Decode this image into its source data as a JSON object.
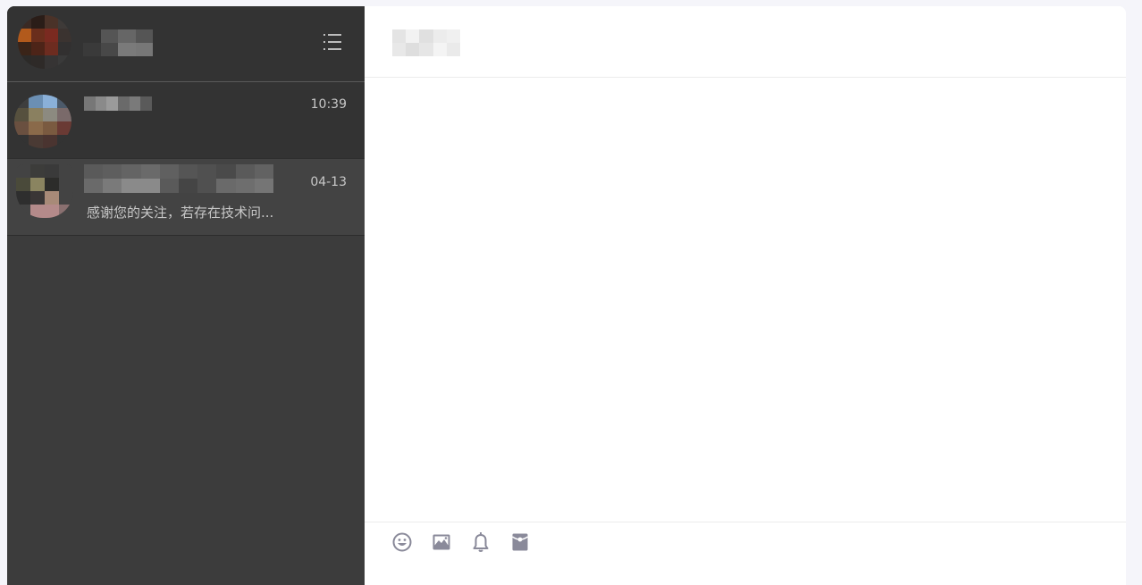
{
  "sidebar": {
    "header": {
      "avatar_colors": [
        "#3a2a24",
        "#2a1d18",
        "#4a3228",
        "#3e3a38",
        "#b25a1c",
        "#6a2e1c",
        "#7a2a20",
        "#3b3330",
        "#3a2418",
        "#4d2418",
        "#6d2c20",
        "#323030",
        "#2c2a28",
        "#2e2a28",
        "#363434",
        "#3a3a3a"
      ],
      "name_colors": [
        "#333333",
        "#555555",
        "#666666",
        "#555555",
        "#3a3a3a",
        "#484848",
        "#7a7a7a",
        "#777777"
      ],
      "menu_icon": "list-menu-icon"
    },
    "conversations": [
      {
        "time": "10:39",
        "preview": "",
        "avatar_colors": [
          "#3e3e3e",
          "#6b8fb3",
          "#8ab0d8",
          "#4c5a6a",
          "#56503e",
          "#8a8060",
          "#8c8a80",
          "#7a6a6a",
          "#6a5040",
          "#8a6a4a",
          "#7a5a40",
          "#6a3a34",
          "#333333",
          "#4a3a34",
          "#4a3430",
          "#333333"
        ],
        "name_colors": [
          "#777777",
          "#8a8a8a",
          "#9a9a9a",
          "#6a6a6a",
          "#7a7a7a",
          "#5a5a5a"
        ]
      },
      {
        "time": "04-13",
        "preview": "感谢您的关注，若存在技术问...",
        "avatar_colors": [
          "#434343",
          "#3c3c3a",
          "#3a3a3a",
          "#434343",
          "#4a4a3a",
          "#8a8460",
          "#2c2c2a",
          "#434343",
          "#2e2e2e",
          "#3a3636",
          "#a88a78",
          "#434343",
          "#434343",
          "#b48a8a",
          "#b48a8a",
          "#8a7070"
        ],
        "name_colors": [
          "#5a5a5a",
          "#5e5e5e",
          "#646464",
          "#6a6a6a",
          "#606060",
          "#555555",
          "#505050",
          "#4a4a4a",
          "#5a5a5a",
          "#626262",
          "#6a6a6a",
          "#7a7a7a",
          "#8a8a8a",
          "#8a8a8a",
          "#5a5a5a",
          "#454545",
          "#505050",
          "#6a6a6a",
          "#6e6e6e",
          "#757575"
        ]
      }
    ]
  },
  "main": {
    "title_colors": [
      "#e4e4e4",
      "#f2f2f2",
      "#e0e0e0",
      "#ececec",
      "#f0f0f0",
      "#e8e8e8",
      "#dedede",
      "#e6e6e6",
      "#f4f4f4",
      "#eaeaea"
    ],
    "toolbar": {
      "icons": [
        "emoji-icon",
        "image-icon",
        "bell-icon",
        "red-packet-icon"
      ],
      "icon_color": "#8a8a9a"
    }
  }
}
